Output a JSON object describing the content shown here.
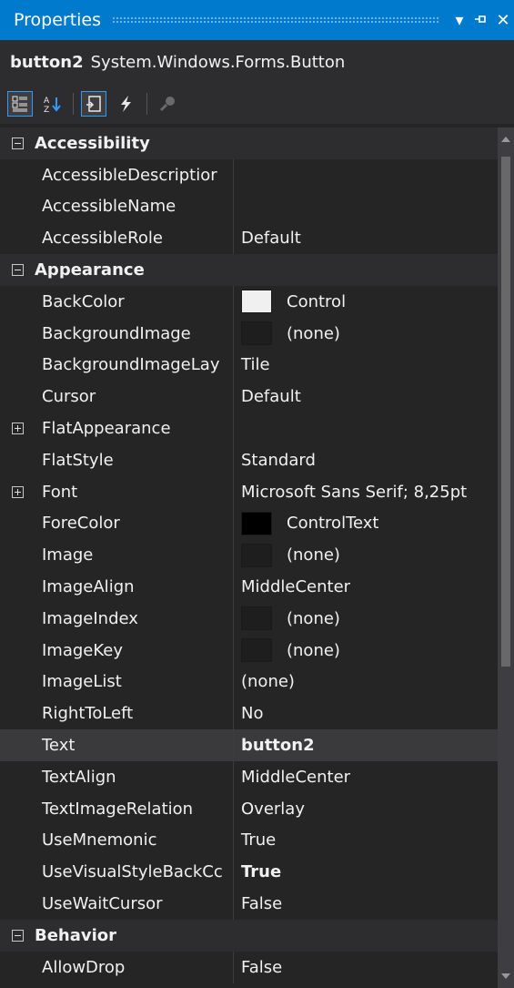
{
  "panel": {
    "title": "Properties"
  },
  "object": {
    "name": "button2",
    "type": "System.Windows.Forms.Button"
  },
  "titlebar_buttons": [
    "dropdown-arrow",
    "pin-icon",
    "close-icon"
  ],
  "toolbar": [
    "categorized-icon",
    "alphabetical-icon",
    "properties-icon",
    "events-icon",
    "property-pages-icon"
  ],
  "colors": {
    "accent": "#007acc",
    "background": "#252526",
    "category": "#2d2d30",
    "control": "#f0f0f0",
    "controltext": "#000000"
  },
  "rows": [
    {
      "kind": "cat",
      "name": "Accessibility",
      "expanded": true
    },
    {
      "kind": "prop",
      "name": "AccessibleDescriptior",
      "value": ""
    },
    {
      "kind": "prop",
      "name": "AccessibleName",
      "value": ""
    },
    {
      "kind": "prop",
      "name": "AccessibleRole",
      "value": "Default"
    },
    {
      "kind": "cat",
      "name": "Appearance",
      "expanded": true
    },
    {
      "kind": "prop",
      "name": "BackColor",
      "value": "Control",
      "swatch": "#f0f0f0"
    },
    {
      "kind": "prop",
      "name": "BackgroundImage",
      "value": "(none)",
      "swatch": "#1e1e1e"
    },
    {
      "kind": "prop",
      "name": "BackgroundImageLay",
      "value": "Tile"
    },
    {
      "kind": "prop",
      "name": "Cursor",
      "value": "Default"
    },
    {
      "kind": "prop",
      "name": "FlatAppearance",
      "value": "",
      "expander": "plus"
    },
    {
      "kind": "prop",
      "name": "FlatStyle",
      "value": "Standard"
    },
    {
      "kind": "prop",
      "name": "Font",
      "value": "Microsoft Sans Serif; 8,25pt",
      "expander": "plus"
    },
    {
      "kind": "prop",
      "name": "ForeColor",
      "value": "ControlText",
      "swatch": "#000000"
    },
    {
      "kind": "prop",
      "name": "Image",
      "value": "(none)",
      "swatch": "#1e1e1e"
    },
    {
      "kind": "prop",
      "name": "ImageAlign",
      "value": "MiddleCenter"
    },
    {
      "kind": "prop",
      "name": "ImageIndex",
      "value": "(none)",
      "swatch": "#1e1e1e"
    },
    {
      "kind": "prop",
      "name": "ImageKey",
      "value": "(none)",
      "swatch": "#1e1e1e"
    },
    {
      "kind": "prop",
      "name": "ImageList",
      "value": "(none)"
    },
    {
      "kind": "prop",
      "name": "RightToLeft",
      "value": "No"
    },
    {
      "kind": "prop",
      "name": "Text",
      "value": "button2",
      "bold": true,
      "selected": true
    },
    {
      "kind": "prop",
      "name": "TextAlign",
      "value": "MiddleCenter"
    },
    {
      "kind": "prop",
      "name": "TextImageRelation",
      "value": "Overlay"
    },
    {
      "kind": "prop",
      "name": "UseMnemonic",
      "value": "True"
    },
    {
      "kind": "prop",
      "name": "UseVisualStyleBackCc",
      "value": "True",
      "bold": true
    },
    {
      "kind": "prop",
      "name": "UseWaitCursor",
      "value": "False"
    },
    {
      "kind": "cat",
      "name": "Behavior",
      "expanded": true
    },
    {
      "kind": "prop",
      "name": "AllowDrop",
      "value": "False"
    }
  ]
}
